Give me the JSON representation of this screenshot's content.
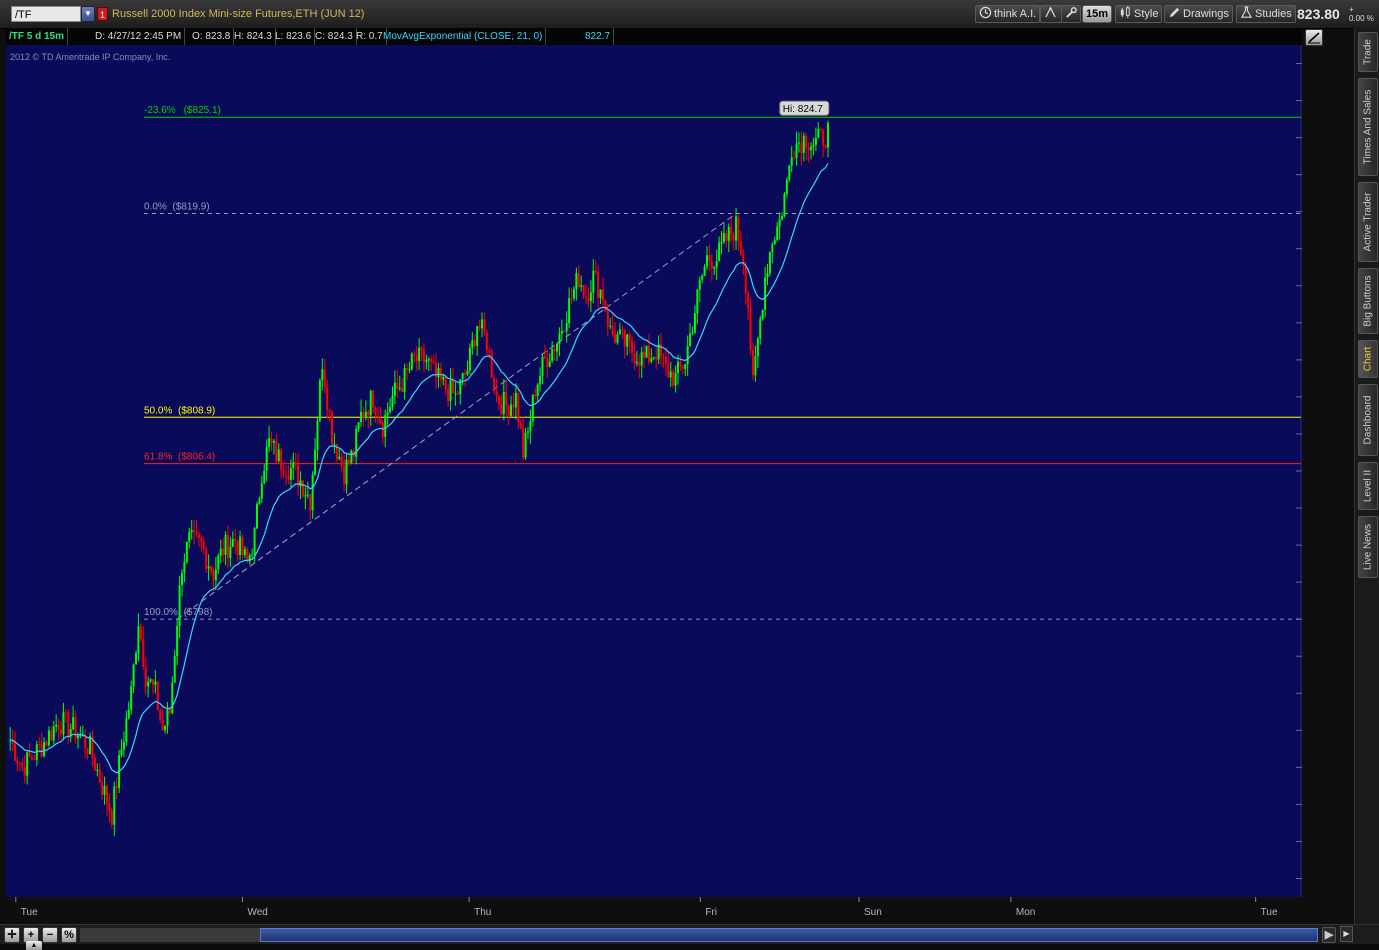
{
  "toolbar": {
    "symbol": "/TF",
    "symbol_flag": "1",
    "description": "Russell 2000 Index Mini-size Futures,ETH (JUN 12)",
    "think_ai_label": "think A.I.",
    "aggregation_label": "15m",
    "style_label": "Style",
    "drawings_label": "Drawings",
    "studies_label": "Studies",
    "last_price": "823.80",
    "change_indicator": "+",
    "change_percent": "0.00 %"
  },
  "info_bar": {
    "title": "/TF 5 d 15m",
    "date": "D: 4/27/12 2:45 PM",
    "open": "O: 823.8",
    "high": "H: 824.3",
    "low": "L: 823.6",
    "close": "C: 824.3",
    "range": "R: 0.7",
    "ema_label": "MovAvgExponential (CLOSE, 21, 0)",
    "ema_value": "822.7"
  },
  "copyright": "2012 © TD Ameritrade IP Company, Inc.",
  "side_tabs": [
    "Trade",
    "Times And Sales",
    "Active Trader",
    "Big Buttons",
    "Chart",
    "Dashboard",
    "Level II",
    "Live News"
  ],
  "active_side_tab": "Chart",
  "colors": {
    "background": "#0a0a5a",
    "candle_up": "#00ff00",
    "candle_down": "#ff0000",
    "ema": "#3ad6ff",
    "fib_green": "#00d000",
    "fib_yellow": "#ffff00",
    "fib_red": "#ff2020",
    "fib_gray": "#9a9ac0"
  },
  "chart_data": {
    "type": "candlestick",
    "ylim": [
      783,
      829
    ],
    "y_ticks": [
      784,
      786,
      788,
      790,
      792,
      794,
      796,
      798,
      800,
      802,
      804,
      806,
      808,
      810,
      812,
      814,
      816,
      818,
      820,
      822,
      824,
      826,
      828
    ],
    "x_labels": [
      "Tue",
      "Wed",
      "Thu",
      "Fri",
      "Sun",
      "Mon",
      "Tue"
    ],
    "fib_levels": [
      {
        "label": "-23.6%",
        "price": "($825.1)",
        "value": 825.1,
        "style": "solid",
        "color": "#00d000"
      },
      {
        "label": "0.0%",
        "price": "($819.9)",
        "value": 819.9,
        "style": "dashed",
        "color": "#9a9ac0"
      },
      {
        "label": "50.0%",
        "price": "($808.9)",
        "value": 808.9,
        "style": "solid",
        "color": "#ffff00"
      },
      {
        "label": "61.8%",
        "price": "($806.4)",
        "value": 806.4,
        "style": "solid",
        "color": "#ff2020"
      },
      {
        "label": "100.0%",
        "price": "($798)",
        "value": 798.0,
        "style": "dashed",
        "color": "#9a9ac0"
      }
    ],
    "hi_label": "Hi: 824.7",
    "price_bubbles": [
      {
        "text": "824.3",
        "value": 824.3,
        "color": "#00e000"
      },
      {
        "text": "822.7",
        "value": 822.7,
        "color": "#3ad6ff"
      }
    ],
    "anchors": [
      [
        0,
        791.5
      ],
      [
        5,
        790
      ],
      [
        12,
        791
      ],
      [
        20,
        792.5
      ],
      [
        27,
        792
      ],
      [
        33,
        791
      ],
      [
        38,
        789
      ],
      [
        42,
        787.5
      ],
      [
        46,
        791
      ],
      [
        50,
        794
      ],
      [
        53,
        798
      ],
      [
        56,
        795
      ],
      [
        60,
        794
      ],
      [
        63,
        792
      ],
      [
        66,
        793
      ],
      [
        69,
        798
      ],
      [
        71,
        801
      ],
      [
        74,
        802.2
      ],
      [
        79,
        802
      ],
      [
        84,
        800.5
      ],
      [
        88,
        801.8
      ],
      [
        93,
        802.3
      ],
      [
        98,
        801
      ],
      [
        101,
        802.5
      ],
      [
        104,
        806
      ],
      [
        107,
        807.5
      ],
      [
        112,
        806.5
      ],
      [
        117,
        806
      ],
      [
        120,
        805.5
      ],
      [
        124,
        804.5
      ],
      [
        127,
        809
      ],
      [
        129,
        812
      ],
      [
        133,
        808
      ],
      [
        138,
        806
      ],
      [
        142,
        807
      ],
      [
        145,
        809
      ],
      [
        150,
        810
      ],
      [
        154,
        808.5
      ],
      [
        158,
        810
      ],
      [
        163,
        811
      ],
      [
        167,
        812
      ],
      [
        172,
        812
      ],
      [
        176,
        811
      ],
      [
        180,
        810.5
      ],
      [
        184,
        810
      ],
      [
        189,
        811.5
      ],
      [
        193,
        814
      ],
      [
        197,
        813
      ],
      [
        201,
        810
      ],
      [
        205,
        809.5
      ],
      [
        209,
        810
      ],
      [
        212,
        807
      ],
      [
        214,
        808
      ],
      [
        217,
        810.5
      ],
      [
        221,
        812
      ],
      [
        226,
        813
      ],
      [
        231,
        815
      ],
      [
        235,
        816.5
      ],
      [
        238,
        815.5
      ],
      [
        241,
        816.5
      ],
      [
        245,
        815.5
      ],
      [
        248,
        813.5
      ],
      [
        253,
        813
      ],
      [
        257,
        812.5
      ],
      [
        262,
        812
      ],
      [
        267,
        812.5
      ],
      [
        271,
        811.5
      ],
      [
        275,
        811
      ],
      [
        279,
        812
      ],
      [
        282,
        814
      ],
      [
        285,
        816
      ],
      [
        288,
        817.5
      ],
      [
        292,
        817.5
      ],
      [
        296,
        818.5
      ],
      [
        300,
        819.2
      ],
      [
        303,
        817.5
      ],
      [
        305,
        815
      ],
      [
        307,
        810.5
      ],
      [
        309,
        813
      ],
      [
        312,
        816.5
      ],
      [
        315,
        818.5
      ],
      [
        318,
        819.5
      ],
      [
        321,
        821.5
      ],
      [
        323,
        823.5
      ],
      [
        326,
        823.8
      ],
      [
        329,
        824
      ],
      [
        332,
        823.7
      ],
      [
        335,
        823.9
      ],
      [
        338,
        824.3
      ]
    ],
    "n_bars": 339,
    "last_bar_index": 338,
    "total_slots": 534,
    "seed": 7
  }
}
